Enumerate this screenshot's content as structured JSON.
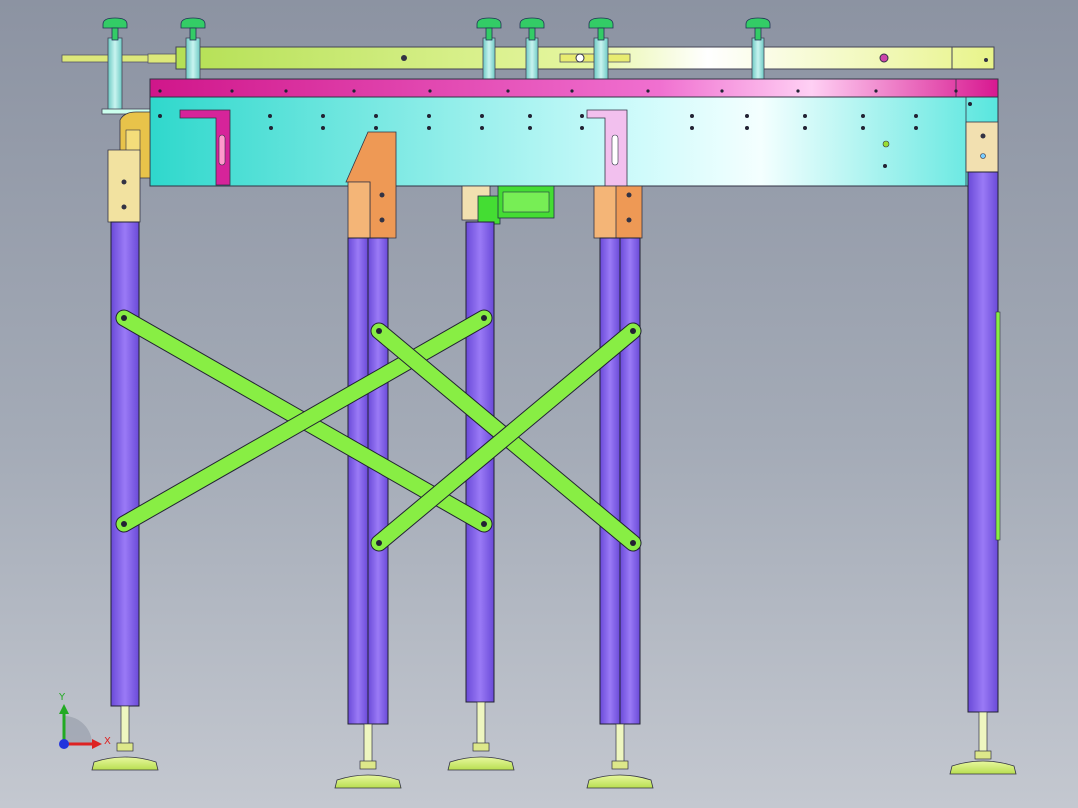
{
  "view": {
    "background_top": "#8c93a2",
    "background_bottom": "#c4c8d0"
  },
  "colors": {
    "frame_cyan": "#2fe0d4",
    "frame_highlight": "#eaffff",
    "top_rail_magenta": "#d8188f",
    "top_guide_yellow_green": "#c8ec60",
    "leg_purple": "#8866ee",
    "leg_purple_dark": "#5a3cc8",
    "cross_brace_green": "#88ee44",
    "bracket_orange": "#ee9955",
    "motor_green": "#44dd33",
    "foot_yellow_green": "#ccee66",
    "knob_green": "#33cc66",
    "axis_x": "#dd2222",
    "axis_y": "#22aa22",
    "axis_z": "#2233dd"
  },
  "triad": {
    "x_label": "X",
    "y_label": "Y"
  }
}
